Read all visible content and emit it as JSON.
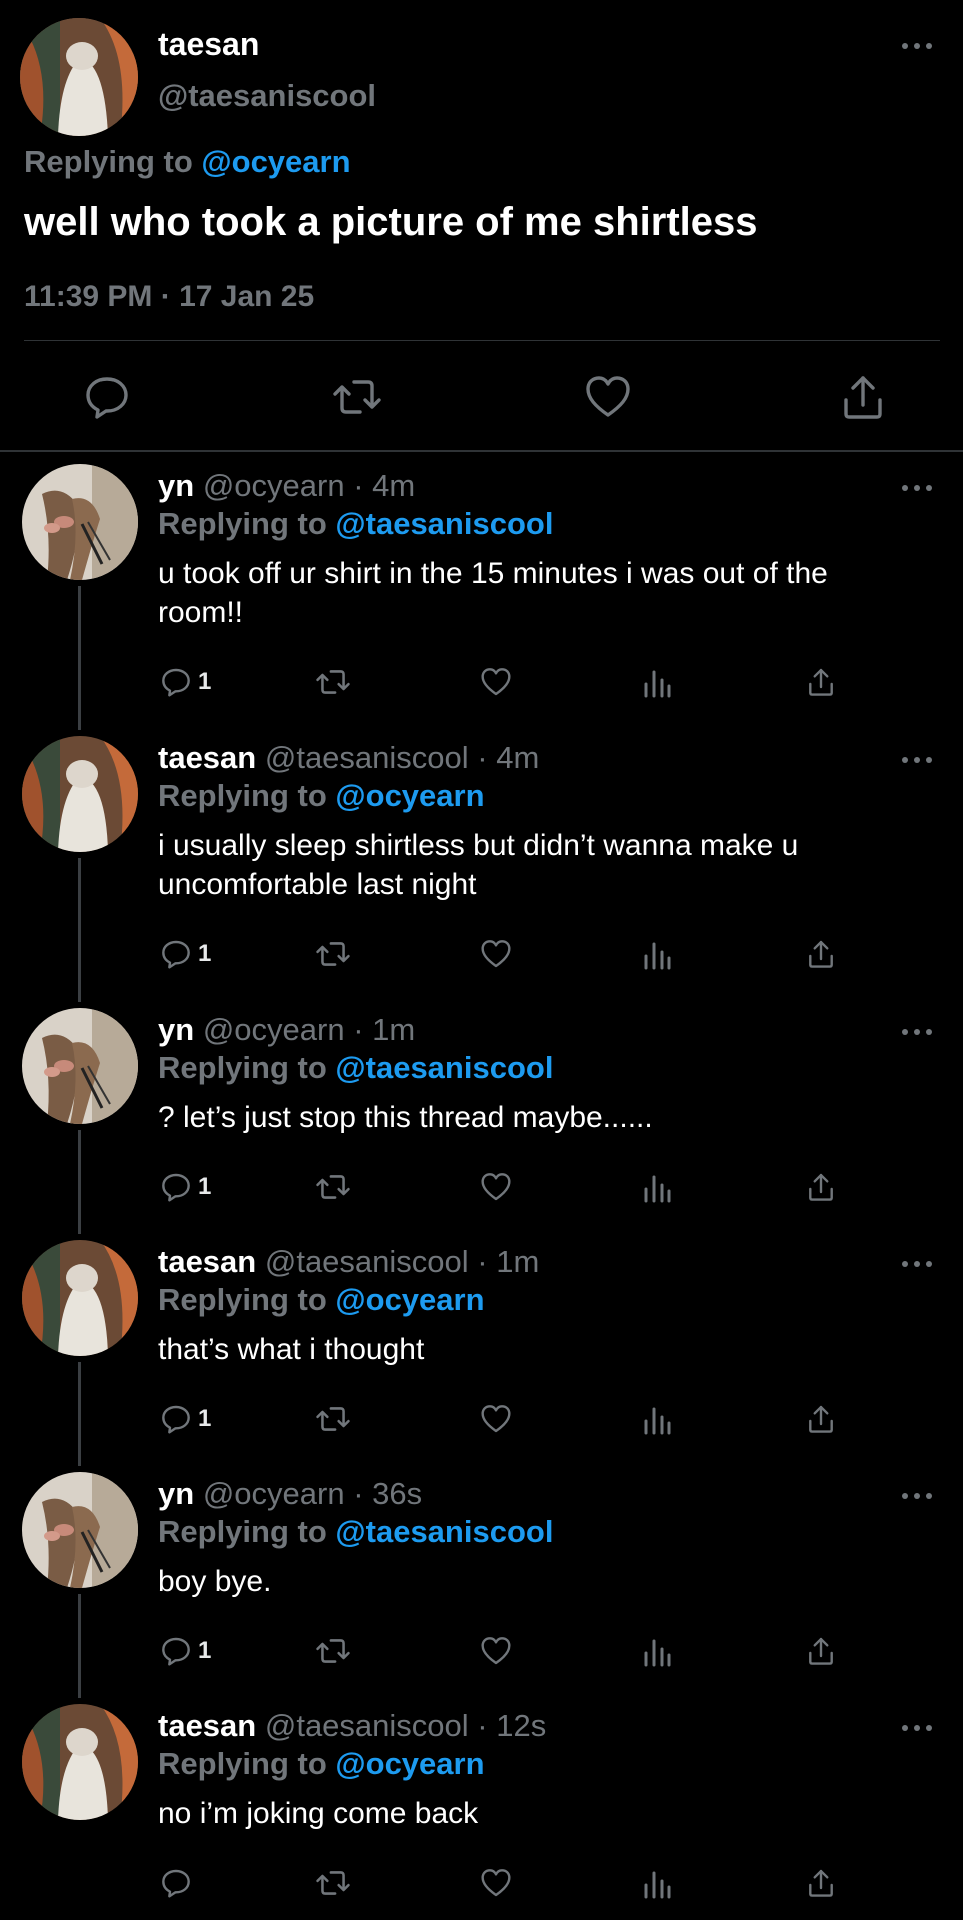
{
  "main": {
    "name": "taesan",
    "handle": "@taesaniscool",
    "replying_prefix": "Replying to",
    "replying_mention": "@ocyearn",
    "text": "well who took a picture of me shirtless",
    "timestamp": "11:39 PM · 17 Jan 25",
    "icons": [
      "reply-icon",
      "retweet-icon",
      "like-icon",
      "share-icon"
    ]
  },
  "replies": [
    {
      "name": "yn",
      "handle": "@ocyearn",
      "time": "· 4m",
      "replying_prefix": "Replying to",
      "replying_mention": "@taesaniscool",
      "text": "u took off ur shirt in the 15 minutes i was out of the room!!",
      "reply_count": "1"
    },
    {
      "name": "taesan",
      "handle": "@taesaniscool",
      "time": "· 4m",
      "replying_prefix": "Replying to",
      "replying_mention": "@ocyearn",
      "text": " i usually sleep shirtless but didn’t wanna make u uncomfortable last night",
      "reply_count": "1"
    },
    {
      "name": "yn",
      "handle": "@ocyearn",
      "time": "· 1m",
      "replying_prefix": "Replying to",
      "replying_mention": "@taesaniscool",
      "text": "? let’s just stop this thread maybe......",
      "reply_count": "1"
    },
    {
      "name": "taesan",
      "handle": "@taesaniscool",
      "time": "· 1m",
      "replying_prefix": "Replying to",
      "replying_mention": "@ocyearn",
      "text": "that’s what i thought",
      "reply_count": "1"
    },
    {
      "name": "yn",
      "handle": "@ocyearn",
      "time": "· 36s",
      "replying_prefix": "Replying to",
      "replying_mention": "@taesaniscool",
      "text": "boy bye.",
      "reply_count": "1"
    },
    {
      "name": "taesan",
      "handle": "@taesaniscool",
      "time": "· 12s",
      "replying_prefix": "Replying to",
      "replying_mention": "@ocyearn",
      "text": "no i’m joking come back",
      "reply_count": ""
    }
  ],
  "colors": {
    "background": "#000000",
    "text": "#ffffff",
    "muted": "#71767b",
    "mention": "#1d9bf0",
    "divider": "#2f3336"
  }
}
